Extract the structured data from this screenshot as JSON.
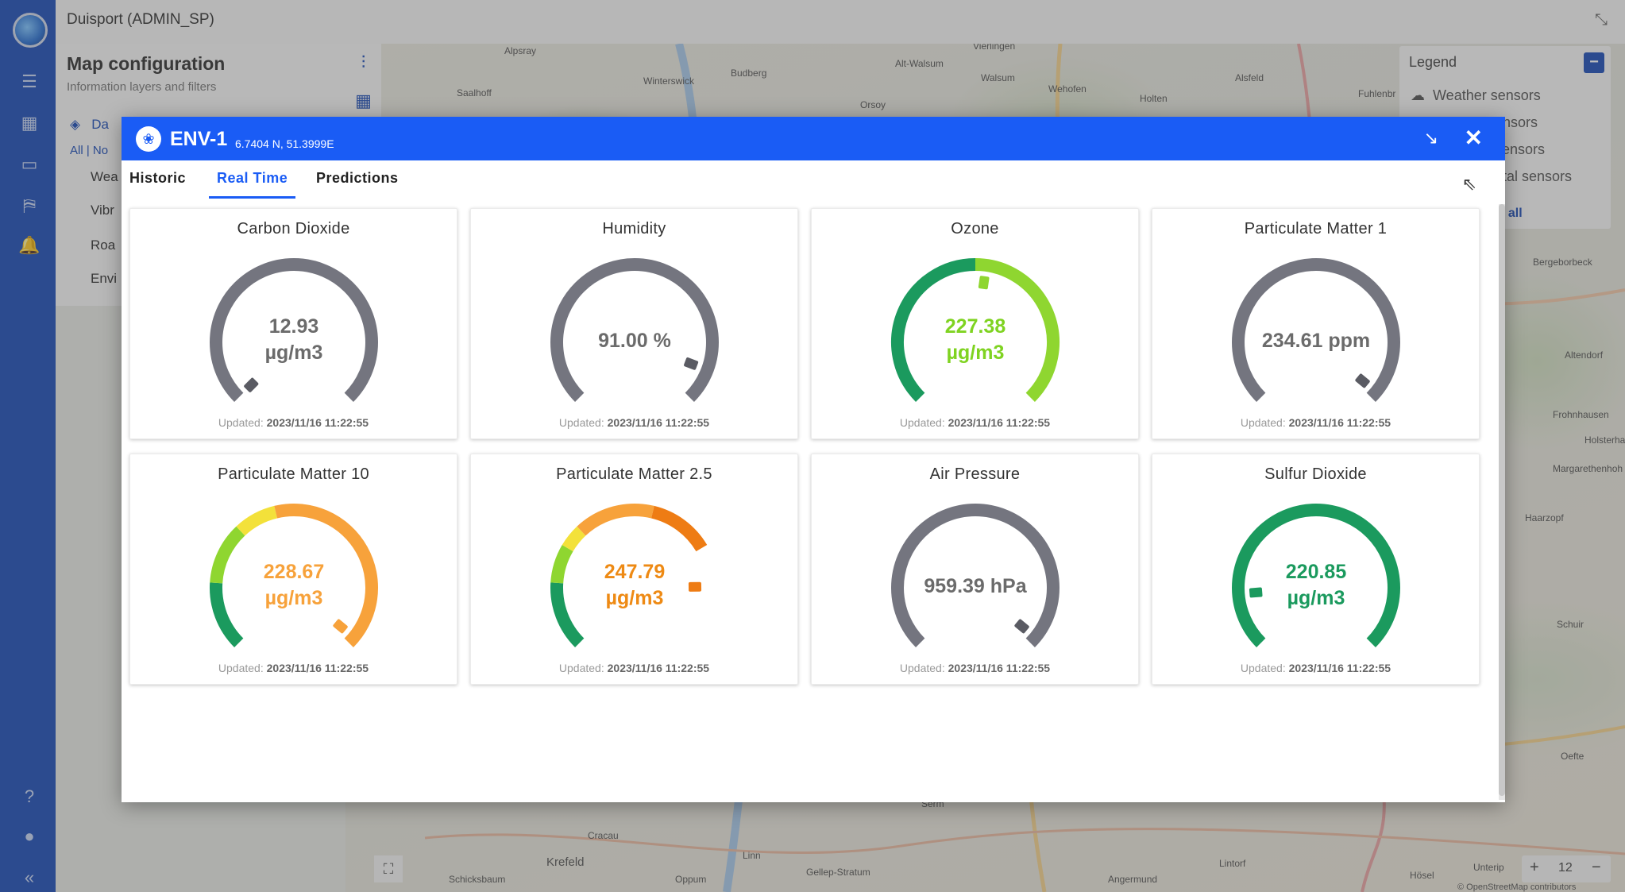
{
  "header": {
    "tenant": "Duisport (ADMIN_SP)"
  },
  "config_panel": {
    "title": "Map configuration",
    "subtitle": "Information layers and filters",
    "layers_label": "Da",
    "filters": [
      "All",
      "No"
    ],
    "categories": [
      "Wea",
      "Vibr",
      "Roa",
      "Envi"
    ]
  },
  "legend": {
    "title": "Legend",
    "items": [
      "Weather sensors",
      "ensors",
      "sensors",
      "ntal sensors"
    ],
    "show_all": "w all"
  },
  "map": {
    "labels": [
      "Alpsray",
      "Saalhoff",
      "Winterswick",
      "Budberg",
      "Orsoy",
      "Vierlingen",
      "Alt-Walsum",
      "Walsum",
      "Wehofen",
      "Holten",
      "Alsfeld",
      "Fuhlenbr",
      "Bergeborbeck",
      "Altendorf",
      "Frohnhausen",
      "Holsterha",
      "Margarethenhoh",
      "Haarzopf",
      "Schuir",
      "Oefte",
      "Krefeld",
      "Cracau",
      "Linn",
      "Gellep-Stratum",
      "Angermund",
      "Lintorf",
      "Hösel",
      "Unterip",
      "Schicksbaum",
      "Oppum",
      "Serm"
    ],
    "zoom_level": "12",
    "zoom_in": "+",
    "zoom_out": "−",
    "attribution": "© OpenStreetMap contributors"
  },
  "modal": {
    "name": "ENV-1",
    "coords": "6.7404 N, 51.3999E",
    "tabs": [
      "Historic",
      "Real Time",
      "Predictions"
    ],
    "active_tab": "Real Time",
    "updated_label": "Updated:",
    "gauges": [
      {
        "title": "Carbon Dioxide",
        "value": "12.93 µg/m3",
        "updated": "2023/11/16 11:22:55",
        "style": "neutral",
        "level": 0.0,
        "text_color": "#6b6b6b"
      },
      {
        "title": "Humidity",
        "value": "91.00 %",
        "updated": "2023/11/16 11:22:55",
        "style": "neutral",
        "level": 0.91,
        "text_color": "#6b6b6b"
      },
      {
        "title": "Ozone",
        "value": "227.38 µg/m3",
        "updated": "2023/11/16 11:22:55",
        "style": "green-lime",
        "level": 0.53,
        "text_color": "#7fd321"
      },
      {
        "title": "Particulate Matter 1",
        "value": "234.61 ppm",
        "updated": "2023/11/16 11:22:55",
        "style": "neutral",
        "level": 0.98,
        "text_color": "#6b6b6b"
      },
      {
        "title": "Particulate Matter 10",
        "value": "228.67 µg/m3",
        "updated": "2023/11/16 11:22:55",
        "style": "multi-orange",
        "level": 0.98,
        "text_color": "#f7a23b"
      },
      {
        "title": "Particulate Matter 2.5",
        "value": "247.79 µg/m3",
        "updated": "2023/11/16 11:22:55",
        "style": "multi-deep-orange",
        "level": 0.83,
        "text_color": "#ee8a14"
      },
      {
        "title": "Air Pressure",
        "value": "959.39 hPa",
        "updated": "2023/11/16 11:22:55",
        "style": "neutral",
        "level": 0.98,
        "text_color": "#6b6b6b"
      },
      {
        "title": "Sulfur Dioxide",
        "value": "220.85 µg/m3",
        "updated": "2023/11/16 11:22:55",
        "style": "green",
        "level": 0.15,
        "text_color": "#1b9a5e"
      }
    ]
  },
  "colors": {
    "brand": "#1f4fb7",
    "modal_header": "#1a5cf5",
    "neutral_arc": "#74757f",
    "green": "#1b9a5e",
    "lime": "#8fd630",
    "yellow": "#f3e13a",
    "orange": "#f7a23b",
    "deep_orange": "#ee7c14"
  }
}
